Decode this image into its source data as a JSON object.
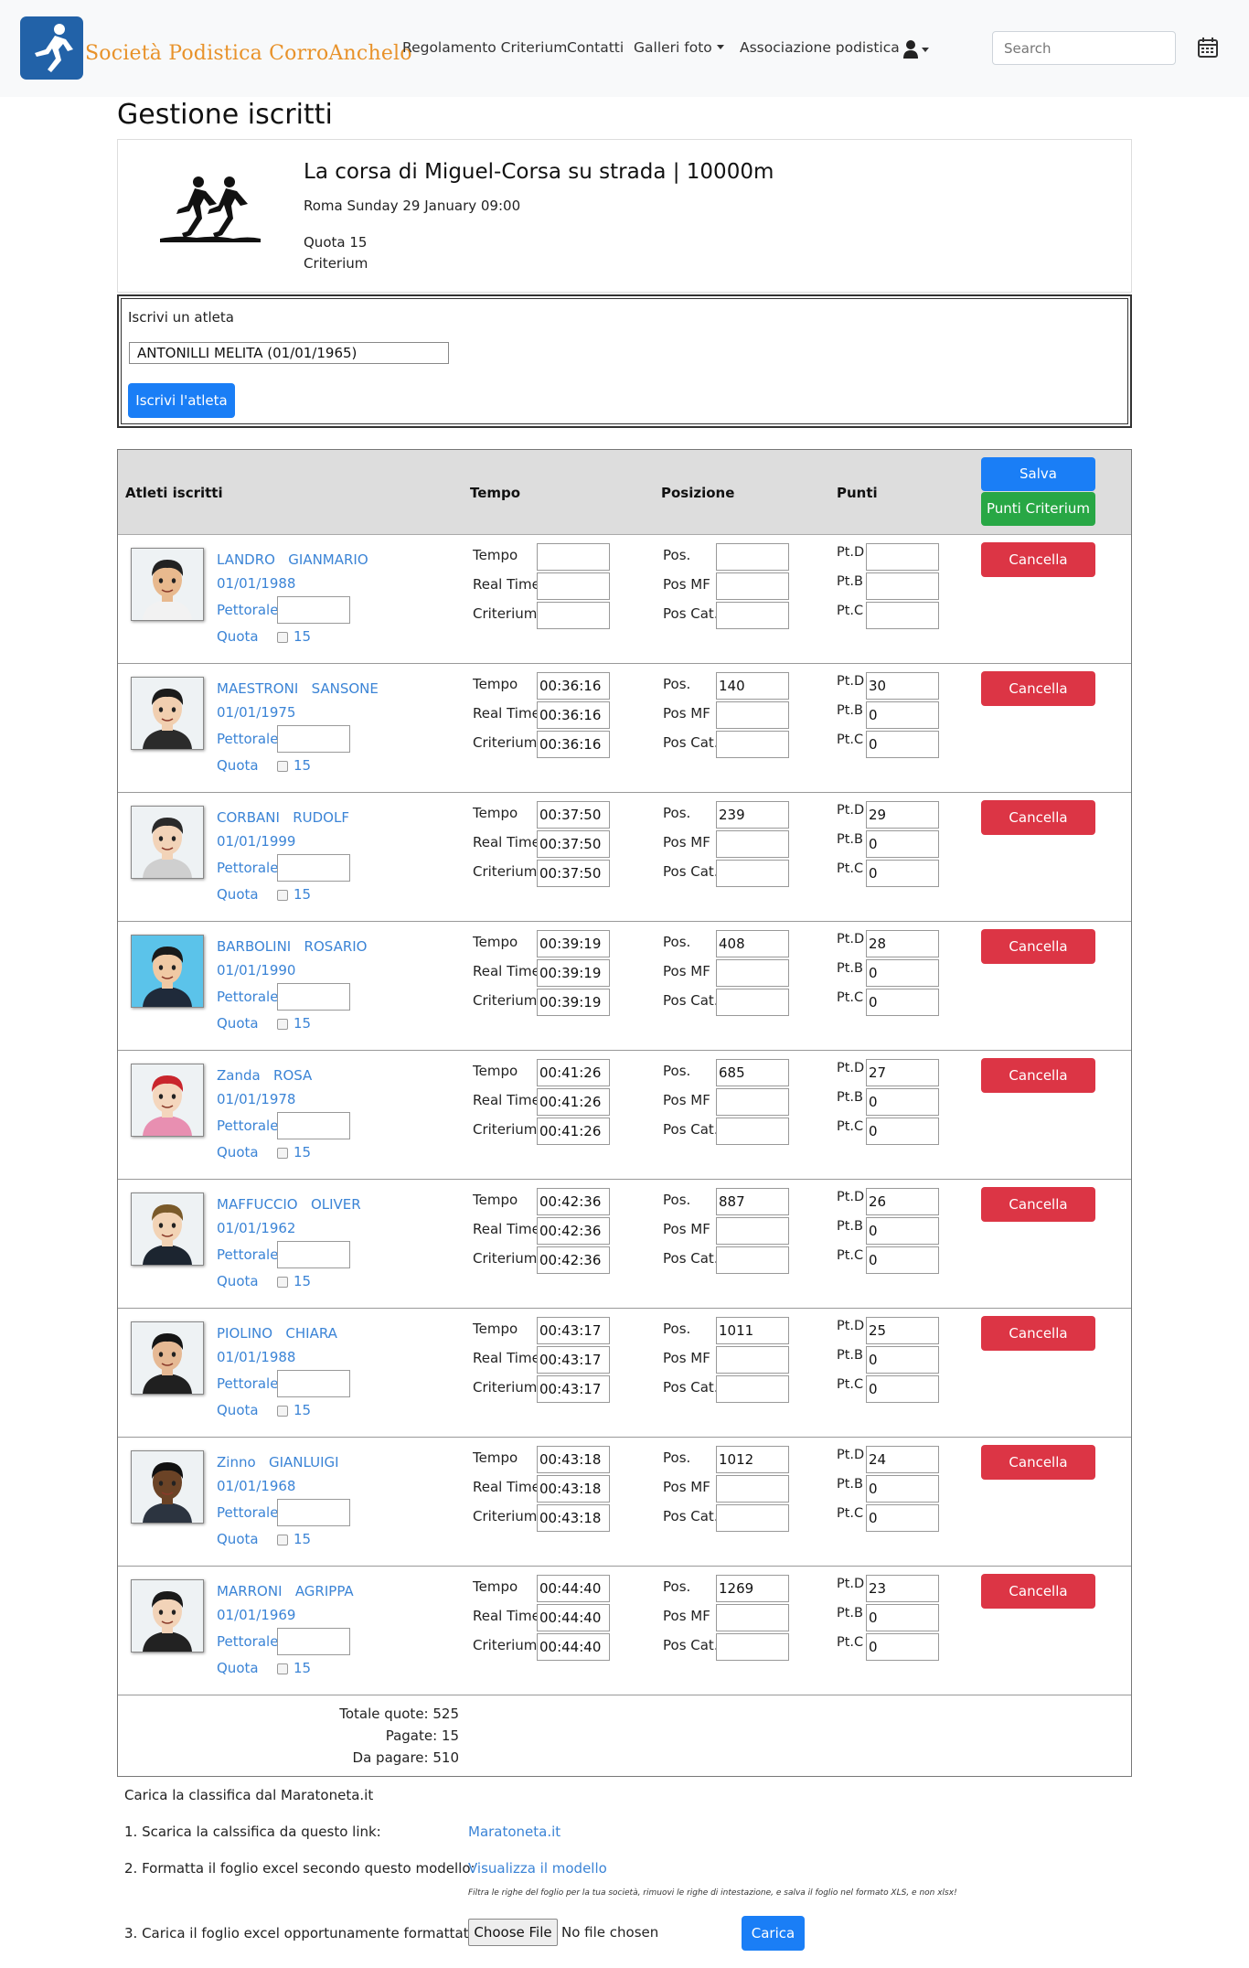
{
  "nav": {
    "brand": "Società Podistica CorroAnchelo",
    "links": [
      "Regolamento Criterium",
      "Contatti",
      "Galleri foto",
      "Associazione podistica"
    ],
    "search_placeholder": "Search"
  },
  "page_title": "Gestione iscritti",
  "event": {
    "title": "La corsa di Miguel-Corsa su strada | 10000m",
    "place_date": "Roma Sunday 29 January 09:00",
    "quota": "Quota 15",
    "criterium": "Criterium"
  },
  "enroll": {
    "label": "Iscrivi un atleta",
    "selected": "ANTONILLI MELITA (01/01/1965)",
    "button": "Iscrivi l'atleta"
  },
  "table": {
    "headers": {
      "athletes": "Atleti iscritti",
      "time": "Tempo",
      "position": "Posizione",
      "points": "Punti"
    },
    "save_button": "Salva",
    "criterium_button": "Punti Criterium",
    "labels": {
      "pettorale": "Pettorale",
      "quota": "Quota",
      "quota_value": "15",
      "tempo": "Tempo",
      "real_time": "Real Time",
      "criterium": "Criterium",
      "pos": "Pos.",
      "pos_mf": "Pos MF",
      "pos_cat": "Pos Cat.",
      "ptd": "Pt.D",
      "ptb": "Pt.B",
      "ptc": "Pt.C",
      "cancel": "Cancella"
    },
    "rows": [
      {
        "surname": "LANDRO",
        "name": "GIANMARIO",
        "birth": "01/01/1988",
        "tempo": "",
        "real": "",
        "crit": "",
        "pos": "",
        "ptd": "",
        "ptb": "",
        "ptc": "",
        "skin": "#e8b98e",
        "hair": "#222",
        "shirt": "#f2f2f2",
        "bg": "#eef2f4"
      },
      {
        "surname": "MAESTRONI",
        "name": "SANSONE",
        "birth": "01/01/1975",
        "tempo": "00:36:16",
        "real": "00:36:16",
        "crit": "00:36:16",
        "pos": "140",
        "ptd": "30",
        "ptb": "0",
        "ptc": "0",
        "skin": "#f1cfb0",
        "hair": "#1b1b1b",
        "shirt": "#2b2b2b",
        "bg": "#eef2f4"
      },
      {
        "surname": "CORBANI",
        "name": "RUDOLF",
        "birth": "01/01/1999",
        "tempo": "00:37:50",
        "real": "00:37:50",
        "crit": "00:37:50",
        "pos": "239",
        "ptd": "29",
        "ptb": "0",
        "ptc": "0",
        "skin": "#f2d3b8",
        "hair": "#2a2a2a",
        "shirt": "#cfcfcf",
        "bg": "#eef2f4"
      },
      {
        "surname": "BARBOLINI",
        "name": "ROSARIO",
        "birth": "01/01/1990",
        "tempo": "00:39:19",
        "real": "00:39:19",
        "crit": "00:39:19",
        "pos": "408",
        "ptd": "28",
        "ptb": "0",
        "ptc": "0",
        "skin": "#f0c9a4",
        "hair": "#1a1a1a",
        "shirt": "#1f2a3a",
        "bg": "#5bc3ea"
      },
      {
        "surname": "Zanda",
        "name": "ROSA",
        "birth": "01/01/1978",
        "tempo": "00:41:26",
        "real": "00:41:26",
        "crit": "00:41:26",
        "pos": "685",
        "ptd": "27",
        "ptb": "0",
        "ptc": "0",
        "skin": "#f4d6bd",
        "hair": "#c9252c",
        "shirt": "#e88fb1",
        "bg": "#eef2f4"
      },
      {
        "surname": "MAFFUCCIO",
        "name": "OLIVER",
        "birth": "01/01/1962",
        "tempo": "00:42:36",
        "real": "00:42:36",
        "crit": "00:42:36",
        "pos": "887",
        "ptd": "26",
        "ptb": "0",
        "ptc": "0",
        "skin": "#f2d3b5",
        "hair": "#7a5a2a",
        "shirt": "#1c2530",
        "bg": "#eef2f4"
      },
      {
        "surname": "PIOLINO",
        "name": "CHIARA",
        "birth": "01/01/1988",
        "tempo": "00:43:17",
        "real": "00:43:17",
        "crit": "00:43:17",
        "pos": "1011",
        "ptd": "25",
        "ptb": "0",
        "ptc": "0",
        "skin": "#e6b994",
        "hair": "#151515",
        "shirt": "#202020",
        "bg": "#eef2f4"
      },
      {
        "surname": "Zinno",
        "name": "GIANLUIGI",
        "birth": "01/01/1968",
        "tempo": "00:43:18",
        "real": "00:43:18",
        "crit": "00:43:18",
        "pos": "1012",
        "ptd": "24",
        "ptb": "0",
        "ptc": "0",
        "skin": "#6b4326",
        "hair": "#111",
        "shirt": "#2c3440",
        "bg": "#eef2f4"
      },
      {
        "surname": "MARRONI",
        "name": "AGRIPPA",
        "birth": "01/01/1969",
        "tempo": "00:44:40",
        "real": "00:44:40",
        "crit": "00:44:40",
        "pos": "1269",
        "ptd": "23",
        "ptb": "0",
        "ptc": "0",
        "skin": "#f2d3b8",
        "hair": "#1a1a1a",
        "shirt": "#222",
        "bg": "#eef2f4"
      }
    ],
    "totals": {
      "total": "Totale quote: 525",
      "paid": "Pagate: 15",
      "due": "Da pagare: 510"
    }
  },
  "upload": {
    "intro": "Carica la classifica dal Maratoneta.it",
    "step1": "1. Scarica la calssifica da questo link:",
    "step1_link": "Maratoneta.it",
    "step2": "2. Formatta il foglio excel secondo questo modello:",
    "step2_link": "Visualizza il modello",
    "note": "Filtra le righe del foglio per la tua società, rimuovi le righe di intestazione, e salva il foglio nel formato XLS, e non xlsx!",
    "step3": "3. Carica il foglio excel opportunamente formattato",
    "choose_file": "Choose File",
    "no_file": "No file chosen",
    "upload_button": "Carica"
  },
  "colors": {
    "primary": "#1a7ef6",
    "success": "#28a745",
    "danger": "#dc3545",
    "link": "#3b84d6",
    "brand": "#e8922a"
  },
  "icons": [
    "runner-logo-icon",
    "user-icon",
    "calendar-icon",
    "runners-icon",
    "avatar-icon"
  ]
}
